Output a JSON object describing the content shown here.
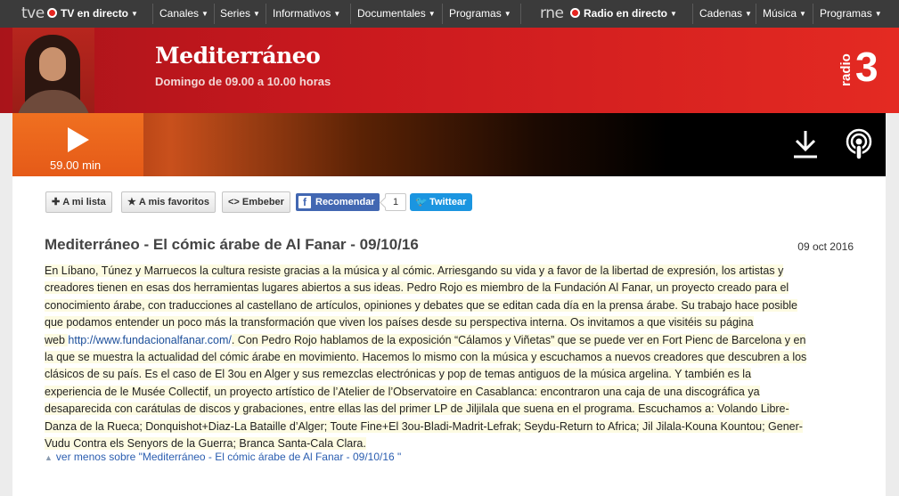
{
  "nav": {
    "tve_logo": "tve",
    "tv_live": "TV en directo",
    "canales": "Canales",
    "series": "Series",
    "informativos": "Informativos",
    "documentales": "Documentales",
    "programas": "Programas",
    "rne_logo": "rne",
    "radio_live": "Radio en directo",
    "cadenas": "Cadenas",
    "musica": "Música",
    "programas_radio": "Programas"
  },
  "header": {
    "program_title": "Mediterráneo",
    "schedule": "Domingo de 09.00 a 10.00 horas",
    "brand_word": "radio",
    "brand_num": "3"
  },
  "player": {
    "duration": "59.00 min"
  },
  "actions": {
    "mi_lista": "A mi lista",
    "favoritos": "A mis favoritos",
    "embeber": "Embeber",
    "recomendar": "Recomendar",
    "fb_count": "1",
    "twittear": "Twittear"
  },
  "episode": {
    "title": "Mediterráneo - El cómic árabe de Al Fanar - 09/10/16",
    "date": "09 oct 2016",
    "description_lines": [
      "En Líbano, Túnez y Marruecos la cultura resiste gracias a la música y al cómic. Arriesgando su vida y a favor de la libertad de expresión, los artistas y",
      "creadores tienen en esas dos herramientas lugares abiertos a sus ideas. Pedro Rojo es miembro de la Fundación Al Fanar, un proyecto creado para el",
      "conocimiento árabe, con traducciones al castellano de artículos, opiniones y debates que se editan cada día en la prensa árabe. Su trabajo hace posible",
      "que podamos entender un poco más la transformación que viven los países desde su perspectiva interna. Os invitamos a que visitéis su página",
      "web ",
      "http://www.fundacionalfanar.com/",
      ". Con Pedro Rojo hablamos de la exposición “Cálamos y Viñetas” que se puede ver en Fort Pienc de Barcelona y en",
      "la que se muestra la actualidad del cómic árabe en movimiento. Hacemos lo mismo con la música y escuchamos a nuevos creadores que descubren a los",
      "clásicos de su país. Es el caso de El 3ou en Alger y sus remezclas electrónicas y pop de temas antiguos de la música argelina. Y también es la",
      "experiencia de le Musée Collectif, un proyecto artístico de l’Atelier de l’Observatoire en Casablanca: encontraron una caja de una discográfica ya",
      "desaparecida con carátulas de discos y grabaciones, entre ellas las del primer LP de Jiljilala que suena en el programa. Escuchamos a: Volando Libre-",
      "Danza de la Rueca; Donquishot+Diaz-La Bataille d’Alger; Toute Fine+El 3ou-Bladi-Madrit-Lefrak; Seydu-Return to Africa; Jil Jilala-Kouna Kountou; Gener-",
      "Vudu Contra els Senyors de la Guerra; Branca Santa-Cala Clara."
    ],
    "less_link": "ver menos sobre \"Mediterráneo - El cómic árabe de Al Fanar - 09/10/16 \""
  }
}
